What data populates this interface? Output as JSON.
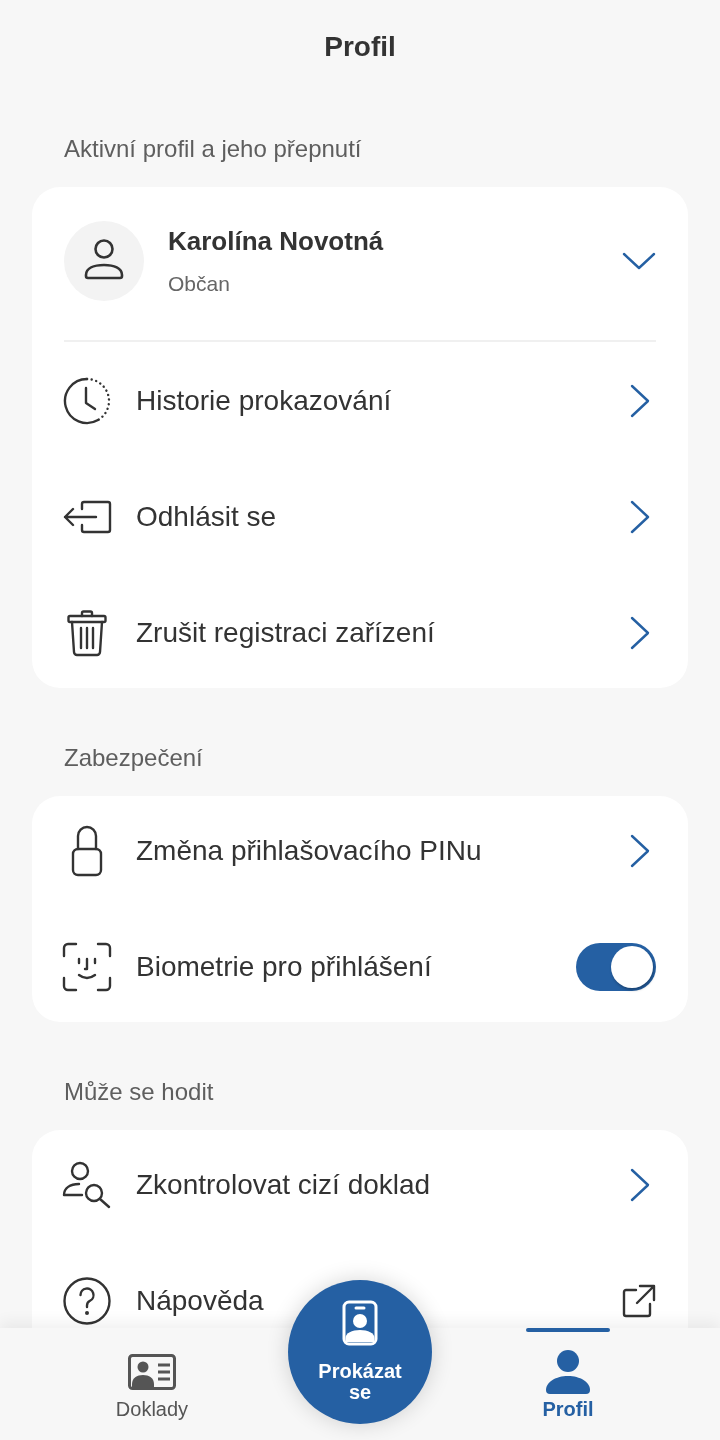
{
  "header": {
    "title": "Profil"
  },
  "sections": [
    {
      "title": "Aktivní profil a jeho přepnutí",
      "profile": {
        "name": "Karolína Novotná",
        "role": "Občan",
        "expanded": false
      },
      "items": [
        {
          "kind": "link",
          "label": "Historie prokazování"
        },
        {
          "kind": "link",
          "label": "Odhlásit se"
        },
        {
          "kind": "link",
          "label": "Zrušit registraci zařízení"
        }
      ]
    },
    {
      "title": "Zabezpečení",
      "items": [
        {
          "kind": "link",
          "label": "Změna přihlašovacího PINu"
        },
        {
          "kind": "toggle",
          "label": "Biometrie pro přihlášení",
          "on": true
        }
      ]
    },
    {
      "title": "Může se hodit",
      "items": [
        {
          "kind": "link",
          "label": "Zkontrolovat cizí doklad"
        },
        {
          "kind": "external",
          "label": "Nápověda"
        }
      ]
    }
  ],
  "bottom_nav": {
    "tabs": [
      {
        "label": "Doklady",
        "selected": false
      },
      {
        "label": "Profil",
        "selected": true
      }
    ],
    "action": {
      "label": "Prokázat se"
    }
  }
}
